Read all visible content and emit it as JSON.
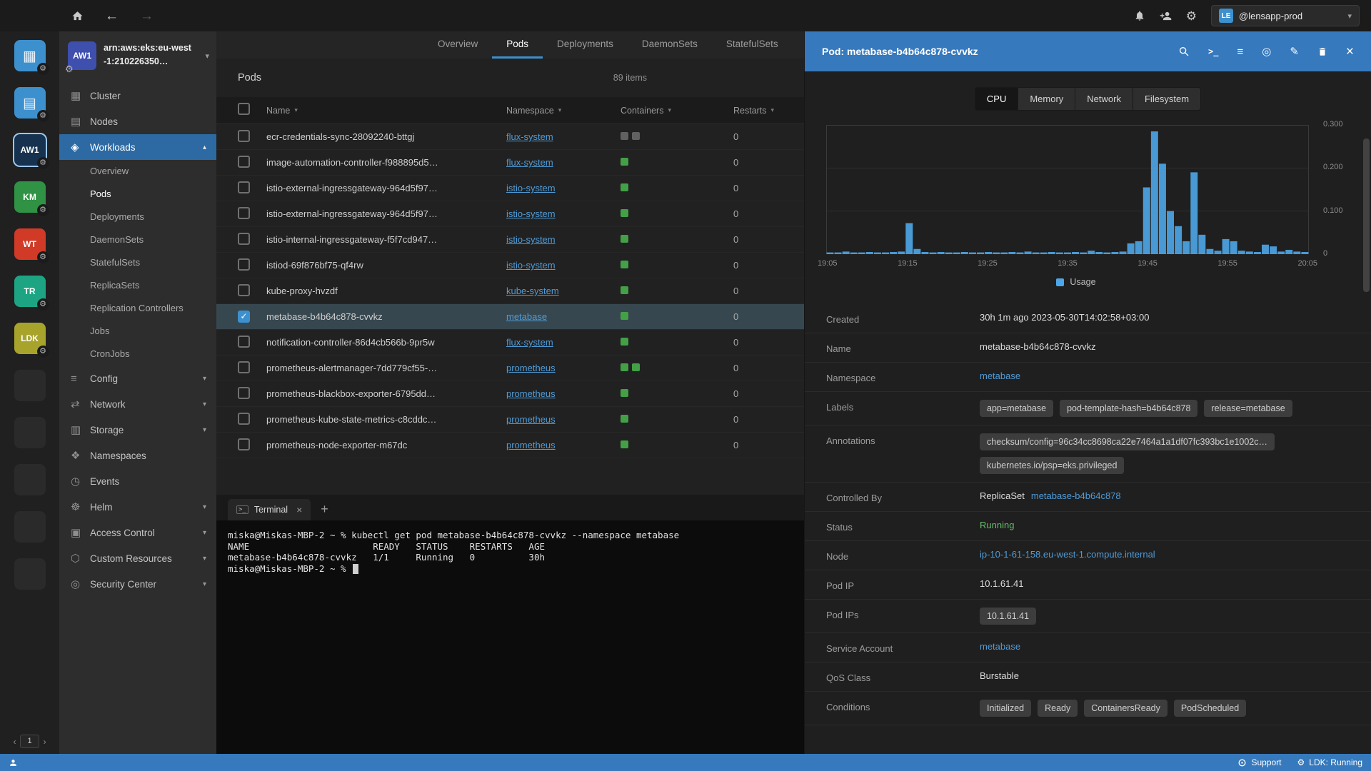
{
  "topbar": {
    "account_initials": "LE",
    "account_name": "@lensapp-prod"
  },
  "hotbar": {
    "tiles": [
      {
        "name": "catalog",
        "glyph": "▦",
        "bg": "#3d90ce",
        "gear": true
      },
      {
        "name": "app-menu",
        "glyph": "▤",
        "bg": "#3d90ce",
        "gear": true
      },
      {
        "name": "cluster-aw1",
        "text": "AW1",
        "bg": "#16324e",
        "selected": true,
        "gear": true
      },
      {
        "name": "cluster-km",
        "text": "KM",
        "bg": "#2f9244",
        "gear": true
      },
      {
        "name": "cluster-wt",
        "text": "WT",
        "bg": "#d03a27",
        "gear": true
      },
      {
        "name": "cluster-tr",
        "text": "TR",
        "bg": "#1da583",
        "gear": true
      },
      {
        "name": "cluster-ldk",
        "text": "LDK",
        "bg": "#a8a42b",
        "gear": true
      }
    ],
    "empty_slots": 5,
    "page": "1"
  },
  "sidebar": {
    "cluster": {
      "badge": "AW1",
      "badge_color": "#3e4fae",
      "name": "arn:aws:eks:eu-west-1:210226350…"
    },
    "items": [
      {
        "label": "Cluster",
        "glyph": "▦"
      },
      {
        "label": "Nodes",
        "glyph": "▤"
      },
      {
        "label": "Workloads",
        "glyph": "◈",
        "expanded": true,
        "active": true,
        "children": [
          {
            "label": "Overview"
          },
          {
            "label": "Pods",
            "active": true
          },
          {
            "label": "Deployments"
          },
          {
            "label": "DaemonSets"
          },
          {
            "label": "StatefulSets"
          },
          {
            "label": "ReplicaSets"
          },
          {
            "label": "Replication Controllers"
          },
          {
            "label": "Jobs"
          },
          {
            "label": "CronJobs"
          }
        ]
      },
      {
        "label": "Config",
        "glyph": "≡",
        "chevron": true
      },
      {
        "label": "Network",
        "glyph": "⇄",
        "chevron": true
      },
      {
        "label": "Storage",
        "glyph": "▥",
        "chevron": true
      },
      {
        "label": "Namespaces",
        "glyph": "❖"
      },
      {
        "label": "Events",
        "glyph": "◷"
      },
      {
        "label": "Helm",
        "glyph": "☸",
        "chevron": true
      },
      {
        "label": "Access Control",
        "glyph": "▣",
        "chevron": true
      },
      {
        "label": "Custom Resources",
        "glyph": "⬡",
        "chevron": true
      },
      {
        "label": "Security Center",
        "glyph": "◎",
        "chevron": true
      }
    ]
  },
  "main_tabs": {
    "items": [
      "Overview",
      "Pods",
      "Deployments",
      "DaemonSets",
      "StatefulSets"
    ],
    "active": "Pods"
  },
  "pods_panel": {
    "title": "Pods",
    "count": "89 items",
    "columns": [
      "Name",
      "Namespace",
      "Containers",
      "Restarts"
    ],
    "rows": [
      {
        "name": "ecr-credentials-sync-28092240-bttgj",
        "namespace": "flux-system",
        "containers": [
          "off",
          "off"
        ],
        "restarts": "0"
      },
      {
        "name": "image-automation-controller-f988895d5…",
        "namespace": "flux-system",
        "containers": [
          "on"
        ],
        "restarts": "0"
      },
      {
        "name": "istio-external-ingressgateway-964d5f97…",
        "namespace": "istio-system",
        "containers": [
          "on"
        ],
        "restarts": "0"
      },
      {
        "name": "istio-external-ingressgateway-964d5f97…",
        "namespace": "istio-system",
        "containers": [
          "on"
        ],
        "restarts": "0"
      },
      {
        "name": "istio-internal-ingressgateway-f5f7cd947…",
        "namespace": "istio-system",
        "containers": [
          "on"
        ],
        "restarts": "0"
      },
      {
        "name": "istiod-69f876bf75-qf4rw",
        "namespace": "istio-system",
        "containers": [
          "on"
        ],
        "restarts": "0"
      },
      {
        "name": "kube-proxy-hvzdf",
        "namespace": "kube-system",
        "containers": [
          "on"
        ],
        "restarts": "0"
      },
      {
        "name": "metabase-b4b64c878-cvvkz",
        "namespace": "metabase",
        "containers": [
          "on"
        ],
        "restarts": "0",
        "selected": true
      },
      {
        "name": "notification-controller-86d4cb566b-9pr5w",
        "namespace": "flux-system",
        "containers": [
          "on"
        ],
        "restarts": "0"
      },
      {
        "name": "prometheus-alertmanager-7dd779cf55-…",
        "namespace": "prometheus",
        "containers": [
          "on",
          "on"
        ],
        "restarts": "0"
      },
      {
        "name": "prometheus-blackbox-exporter-6795dd…",
        "namespace": "prometheus",
        "containers": [
          "on"
        ],
        "restarts": "0"
      },
      {
        "name": "prometheus-kube-state-metrics-c8cddc…",
        "namespace": "prometheus",
        "containers": [
          "on"
        ],
        "restarts": "0"
      },
      {
        "name": "prometheus-node-exporter-m67dc",
        "namespace": "prometheus",
        "containers": [
          "on"
        ],
        "restarts": "0"
      }
    ]
  },
  "terminal": {
    "tab_label": "Terminal",
    "lines": [
      "miska@Miskas-MBP-2 ~ % kubectl get pod metabase-b4b64c878-cvvkz --namespace metabase",
      "NAME                       READY   STATUS    RESTARTS   AGE",
      "metabase-b4b64c878-cvvkz   1/1     Running   0          30h",
      "miska@Miskas-MBP-2 ~ % "
    ]
  },
  "drawer": {
    "title": "Pod: metabase-b4b64c878-cvvkz",
    "tabs": {
      "items": [
        "CPU",
        "Memory",
        "Network",
        "Filesystem"
      ],
      "active": "CPU"
    },
    "fields": [
      {
        "label": "Created",
        "type": "text",
        "value": "30h 1m ago 2023-05-30T14:02:58+03:00"
      },
      {
        "label": "Name",
        "type": "text",
        "value": "metabase-b4b64c878-cvvkz"
      },
      {
        "label": "Namespace",
        "type": "link",
        "value": "metabase"
      },
      {
        "label": "Labels",
        "type": "badges",
        "values": [
          "app=metabase",
          "pod-template-hash=b4b64c878",
          "release=metabase"
        ]
      },
      {
        "label": "Annotations",
        "type": "badges-stacked",
        "values": [
          "checksum/config=96c34cc8698ca22e7464a1a1df07fc393bc1e1002c…",
          "kubernetes.io/psp=eks.privileged"
        ]
      },
      {
        "label": "Controlled By",
        "type": "mixed",
        "prefix": "ReplicaSet ",
        "link": "metabase-b4b64c878"
      },
      {
        "label": "Status",
        "type": "status",
        "value": "Running",
        "color": "#66bb6a"
      },
      {
        "label": "Node",
        "type": "link",
        "value": "ip-10-1-61-158.eu-west-1.compute.internal"
      },
      {
        "label": "Pod IP",
        "type": "text",
        "value": "10.1.61.41"
      },
      {
        "label": "Pod IPs",
        "type": "badges",
        "values": [
          "10.1.61.41"
        ]
      },
      {
        "label": "Service Account",
        "type": "link",
        "value": "metabase"
      },
      {
        "label": "QoS Class",
        "type": "text",
        "value": "Burstable"
      },
      {
        "label": "Conditions",
        "type": "badges",
        "values": [
          "Initialized",
          "Ready",
          "ContainersReady",
          "PodScheduled"
        ]
      }
    ]
  },
  "chart_data": {
    "type": "bar",
    "series": [
      {
        "name": "Usage",
        "color": "#4da6e8",
        "values": [
          0.004,
          0.004,
          0.006,
          0.004,
          0.004,
          0.005,
          0.004,
          0.004,
          0.005,
          0.006,
          0.072,
          0.012,
          0.005,
          0.004,
          0.005,
          0.004,
          0.004,
          0.005,
          0.004,
          0.004,
          0.005,
          0.004,
          0.004,
          0.005,
          0.004,
          0.006,
          0.004,
          0.004,
          0.005,
          0.004,
          0.004,
          0.005,
          0.004,
          0.008,
          0.005,
          0.004,
          0.005,
          0.006,
          0.025,
          0.03,
          0.155,
          0.285,
          0.21,
          0.1,
          0.065,
          0.03,
          0.19,
          0.045,
          0.012,
          0.008,
          0.035,
          0.03,
          0.008,
          0.006,
          0.005,
          0.022,
          0.018,
          0.006,
          0.01,
          0.006,
          0.005
        ]
      }
    ],
    "x_labels": [
      "19:05",
      "19:15",
      "19:25",
      "19:35",
      "19:45",
      "19:55",
      "20:05"
    ],
    "y_tick_labels": [
      "0.300",
      "0.200",
      "0.100",
      "0"
    ],
    "ylim": [
      0,
      0.3
    ],
    "grid": true,
    "legend_position": "bottom-center"
  },
  "statusbar": {
    "support_label": "Support",
    "cluster_status": "LDK: Running"
  },
  "colors": {
    "accent": "#3d90ce",
    "link": "#509bd6",
    "running_green": "#66bb6a",
    "bar_blue": "#4da6e8"
  }
}
